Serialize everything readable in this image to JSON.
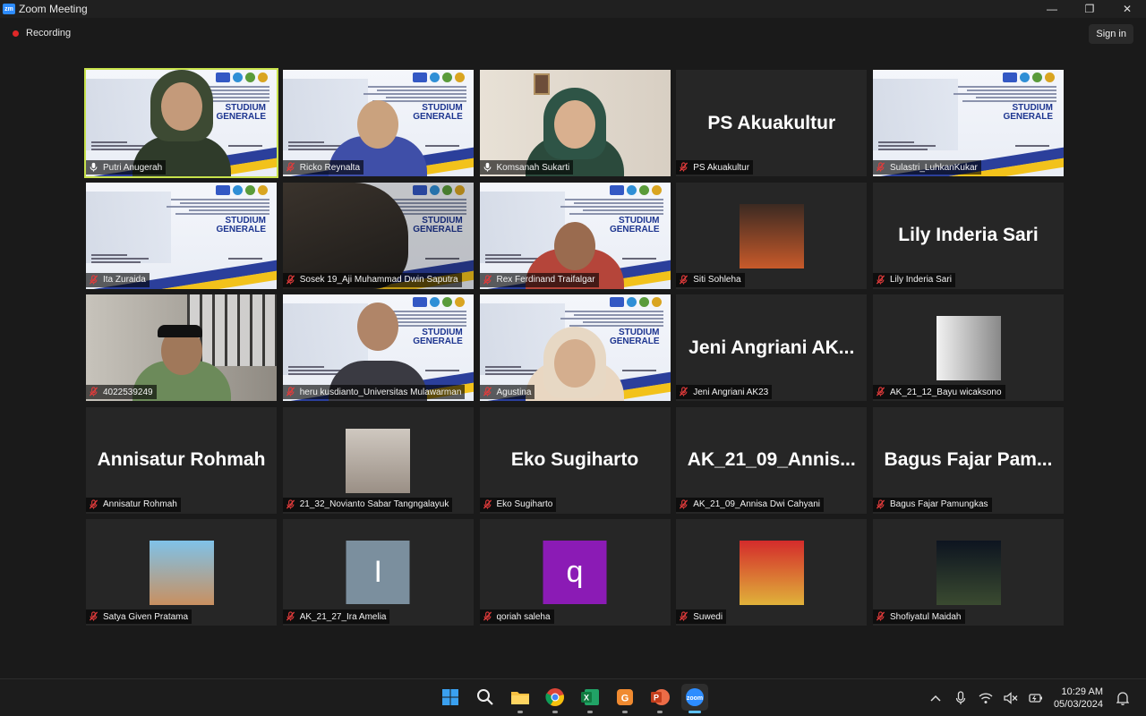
{
  "window": {
    "title": "Zoom Meeting",
    "app_icon_text": "zm"
  },
  "topbar": {
    "recording_label": "Recording",
    "signin_label": "Sign in"
  },
  "slide": {
    "title_line1": "STUDIUM",
    "title_line2": "GENERALE"
  },
  "participants": [
    {
      "name": "Putri Anugerah",
      "video": "slide-person",
      "muted": false,
      "active_speaker": true
    },
    {
      "name": "Ricko Reynalta",
      "video": "slide-person",
      "muted": true
    },
    {
      "name": "Komsanah Sukarti",
      "video": "person",
      "muted": false
    },
    {
      "name": "PS Akuakultur",
      "big_name": "PS Akuakultur",
      "video": "none",
      "muted": true
    },
    {
      "name": "Sulastri_LuhkanKukar",
      "video": "slide",
      "muted": true
    },
    {
      "name": "Ita Zuraida",
      "video": "slide",
      "muted": true
    },
    {
      "name": "Sosek 19_Aji Muhammad Dwin Saputra",
      "video": "slide-dark",
      "muted": true
    },
    {
      "name": "Rex Ferdinand Traifalgar",
      "video": "slide-person",
      "muted": true
    },
    {
      "name": "Siti Sohleha",
      "video": "avatar",
      "muted": true
    },
    {
      "name": "Lily Inderia Sari",
      "big_name": "Lily Inderia Sari",
      "video": "none",
      "muted": true
    },
    {
      "name": "4022539249",
      "video": "person",
      "muted": true
    },
    {
      "name": "heru kusdianto_Universitas Mulawarman",
      "video": "slide-person",
      "muted": true
    },
    {
      "name": "Agustina",
      "video": "slide-person",
      "muted": true
    },
    {
      "name": "Jeni Angriani AK23",
      "big_name": "Jeni Angriani AK...",
      "video": "none",
      "muted": true
    },
    {
      "name": "AK_21_12_Bayu wicaksono",
      "video": "avatar",
      "muted": true
    },
    {
      "name": "Annisatur Rohmah",
      "big_name": "Annisatur Rohmah",
      "video": "none",
      "muted": true
    },
    {
      "name": "21_32_Novianto Sabar Tangngalayuk",
      "video": "avatar",
      "muted": true
    },
    {
      "name": "Eko Sugiharto",
      "big_name": "Eko Sugiharto",
      "video": "none",
      "muted": true
    },
    {
      "name": "AK_21_09_Annisa Dwi Cahyani",
      "big_name": "AK_21_09_Annis...",
      "video": "none",
      "muted": true
    },
    {
      "name": "Bagus Fajar Pamungkas",
      "big_name": "Bagus Fajar Pam...",
      "video": "none",
      "muted": true
    },
    {
      "name": "Satya Given Pratama",
      "video": "avatar",
      "muted": true
    },
    {
      "name": "AK_21_27_Ira Amelia",
      "video": "letter",
      "letter": "I",
      "letter_color": "#7b8f9e",
      "muted": true
    },
    {
      "name": "qoriah saleha",
      "video": "letter",
      "letter": "q",
      "letter_color": "#8b1bb5",
      "muted": true
    },
    {
      "name": "Suwedi",
      "video": "avatar",
      "muted": true
    },
    {
      "name": "Shofiyatul Maidah",
      "video": "avatar",
      "muted": true
    }
  ],
  "colors": {
    "active_border": "#c7e14b",
    "muted_icon": "#e23b3b",
    "tile_bg": "#262626"
  },
  "taskbar": {
    "icons": [
      "windows-start-icon",
      "search-icon",
      "file-explorer-icon",
      "chrome-icon",
      "excel-icon",
      "wps-icon",
      "powerpoint-icon",
      "zoom-icon"
    ],
    "time": "10:29 AM",
    "date": "05/03/2024"
  }
}
